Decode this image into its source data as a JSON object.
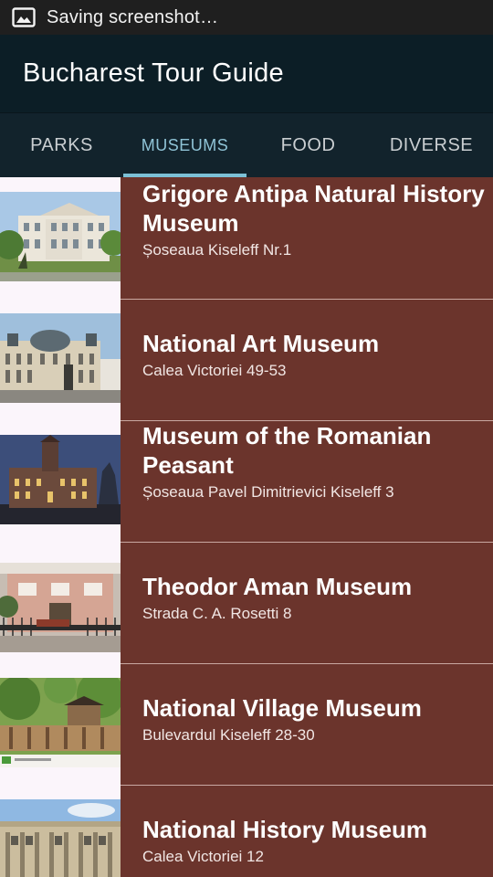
{
  "status_bar": {
    "text": "Saving screenshot…",
    "icon": "image-icon"
  },
  "app_bar": {
    "title": "Bucharest Tour Guide"
  },
  "tabs": [
    {
      "label": "PARKS",
      "active": false
    },
    {
      "label": "MUSEUMS",
      "active": true
    },
    {
      "label": "FOOD",
      "active": false
    },
    {
      "label": "DIVERSE",
      "active": false
    }
  ],
  "museums": [
    {
      "name": "Grigore Antipa Natural History Museum",
      "address": "Șoseaua Kiseleff Nr.1"
    },
    {
      "name": "National Art Museum",
      "address": "Calea Victoriei 49-53"
    },
    {
      "name": "Museum of the Romanian Peasant",
      "address": "Șoseaua Pavel Dimitrievici Kiseleff 3"
    },
    {
      "name": "Theodor Aman Museum",
      "address": "Strada C. A. Rosetti 8"
    },
    {
      "name": "National Village Museum",
      "address": "Bulevardul Kiseleff 28-30"
    },
    {
      "name": "National History Museum",
      "address": "Calea Victoriei 12"
    }
  ],
  "colors": {
    "status_bar": "#1f1f1f",
    "app_bar": "#0c1e26",
    "tab_bar": "#12232c",
    "tab_indicator": "#7cc0d6",
    "list_item_background": "#6b342c",
    "thumbnail_column": "#fbf5fb"
  }
}
